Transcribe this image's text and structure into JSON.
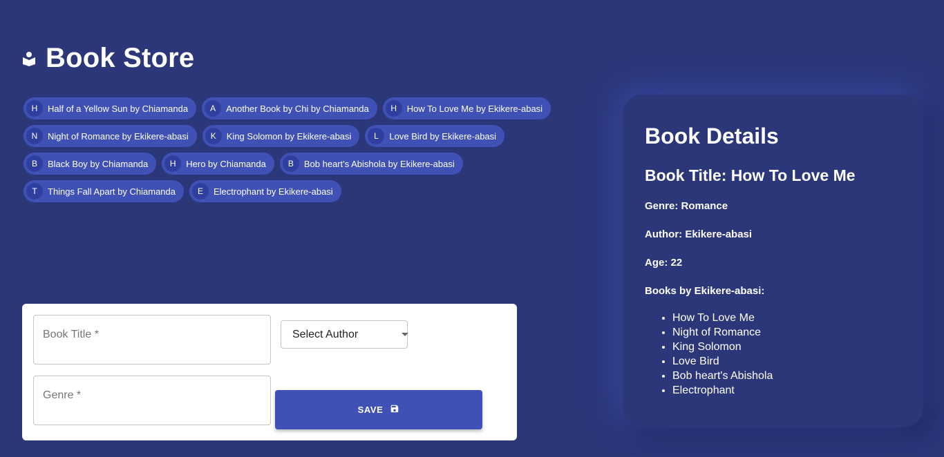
{
  "header": {
    "title": "Book Store",
    "icon": "book-reader-icon"
  },
  "books": [
    {
      "initial": "H",
      "label": "Half of a Yellow Sun by Chiamanda"
    },
    {
      "initial": "A",
      "label": "Another Book by Chi by Chiamanda"
    },
    {
      "initial": "H",
      "label": "How To Love Me by Ekikere-abasi"
    },
    {
      "initial": "N",
      "label": "Night of Romance by Ekikere-abasi"
    },
    {
      "initial": "K",
      "label": "King Solomon by Ekikere-abasi"
    },
    {
      "initial": "L",
      "label": "Love Bird by Ekikere-abasi"
    },
    {
      "initial": "B",
      "label": "Black Boy by Chiamanda"
    },
    {
      "initial": "H",
      "label": "Hero by Chiamanda"
    },
    {
      "initial": "B",
      "label": "Bob heart's Abishola by Ekikere-abasi"
    },
    {
      "initial": "T",
      "label": "Things Fall Apart by Chiamanda"
    },
    {
      "initial": "E",
      "label": "Electrophant by Ekikere-abasi"
    }
  ],
  "form": {
    "book_title_placeholder": "Book Title *",
    "genre_placeholder": "Genre *",
    "author_select_value": "Select Author",
    "save_label": "SAVE"
  },
  "details": {
    "heading": "Book Details",
    "book_title": "Book Title: How To Love Me",
    "genre": "Genre: Romance",
    "author": "Author: Ekikere-abasi",
    "age": "Age: 22",
    "books_by_heading": "Books by Ekikere-abasi:",
    "books_by": [
      "How To Love Me",
      "Night of Romance",
      "King Solomon",
      "Love Bird",
      "Bob heart's Abishola",
      "Electrophant"
    ]
  },
  "colors": {
    "background": "#2c377a",
    "primary": "#3f51b5",
    "avatar": "#303f9f"
  }
}
